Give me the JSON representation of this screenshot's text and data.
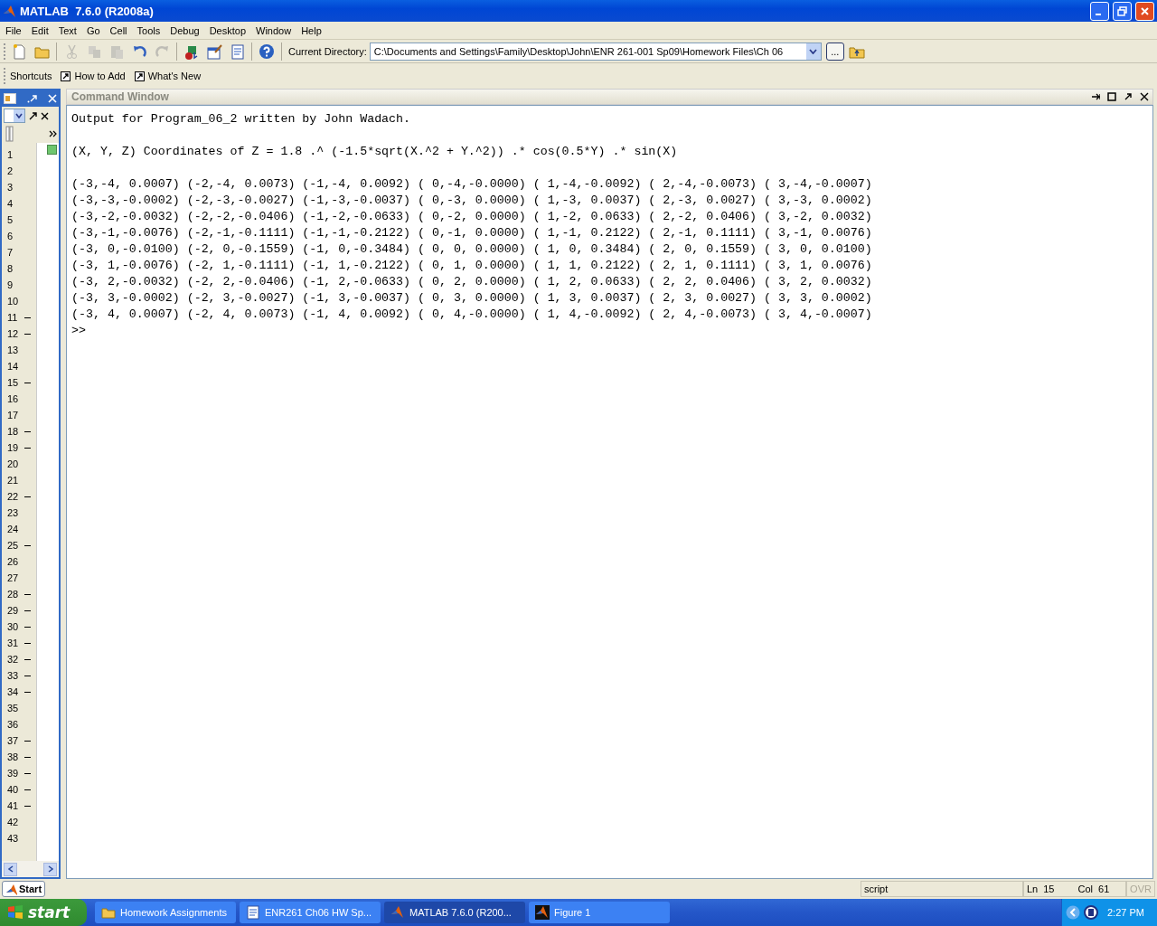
{
  "window": {
    "title": "MATLAB  7.6.0 (R2008a)"
  },
  "menu": [
    "File",
    "Edit",
    "Text",
    "Go",
    "Cell",
    "Tools",
    "Debug",
    "Desktop",
    "Window",
    "Help"
  ],
  "toolbar": {
    "tools": [
      {
        "kind": "new",
        "disabled": false
      },
      {
        "kind": "open",
        "disabled": false
      },
      {
        "kind": "sep"
      },
      {
        "kind": "cut",
        "disabled": true
      },
      {
        "kind": "copy",
        "disabled": true
      },
      {
        "kind": "paste",
        "disabled": true
      },
      {
        "kind": "undo",
        "disabled": false
      },
      {
        "kind": "redo",
        "disabled": true
      },
      {
        "kind": "sep"
      },
      {
        "kind": "simulink",
        "disabled": false
      },
      {
        "kind": "guide",
        "disabled": false
      },
      {
        "kind": "profiler",
        "disabled": false
      },
      {
        "kind": "sep"
      },
      {
        "kind": "help",
        "disabled": false
      },
      {
        "kind": "sep"
      }
    ],
    "directory_label": "Current Directory:",
    "directory": "C:\\Documents and Settings\\Family\\Desktop\\John\\ENR 261-001 Sp09\\Homework Files\\Ch 06",
    "browse": "..."
  },
  "shortcuts": {
    "label": "Shortcuts",
    "items": [
      "How to Add",
      "What's New"
    ]
  },
  "side_panel": {
    "lines": [
      {
        "number": "1",
        "marker": false
      },
      {
        "number": "2",
        "marker": false
      },
      {
        "number": "3",
        "marker": false
      },
      {
        "number": "4",
        "marker": false
      },
      {
        "number": "5",
        "marker": false
      },
      {
        "number": "6",
        "marker": false
      },
      {
        "number": "7",
        "marker": false
      },
      {
        "number": "8",
        "marker": false
      },
      {
        "number": "9",
        "marker": false
      },
      {
        "number": "10",
        "marker": false
      },
      {
        "number": "11",
        "marker": true
      },
      {
        "number": "12",
        "marker": true
      },
      {
        "number": "13",
        "marker": false
      },
      {
        "number": "14",
        "marker": false
      },
      {
        "number": "15",
        "marker": true
      },
      {
        "number": "16",
        "marker": false
      },
      {
        "number": "17",
        "marker": false
      },
      {
        "number": "18",
        "marker": true
      },
      {
        "number": "19",
        "marker": true
      },
      {
        "number": "20",
        "marker": false
      },
      {
        "number": "21",
        "marker": false
      },
      {
        "number": "22",
        "marker": true
      },
      {
        "number": "23",
        "marker": false
      },
      {
        "number": "24",
        "marker": false
      },
      {
        "number": "25",
        "marker": true
      },
      {
        "number": "26",
        "marker": false
      },
      {
        "number": "27",
        "marker": false
      },
      {
        "number": "28",
        "marker": true
      },
      {
        "number": "29",
        "marker": true
      },
      {
        "number": "30",
        "marker": true
      },
      {
        "number": "31",
        "marker": true
      },
      {
        "number": "32",
        "marker": true
      },
      {
        "number": "33",
        "marker": true
      },
      {
        "number": "34",
        "marker": true
      },
      {
        "number": "35",
        "marker": false
      },
      {
        "number": "36",
        "marker": false
      },
      {
        "number": "37",
        "marker": true
      },
      {
        "number": "38",
        "marker": true
      },
      {
        "number": "39",
        "marker": true
      },
      {
        "number": "40",
        "marker": true
      },
      {
        "number": "41",
        "marker": true
      },
      {
        "number": "42",
        "marker": false
      },
      {
        "number": "43",
        "marker": false
      }
    ]
  },
  "command_window": {
    "title": "Command Window",
    "output": [
      {
        "kind": "header",
        "text": "Output for Program_06_2 written by John Wadach."
      },
      {
        "kind": "header",
        "text": "(X, Y, Z) Coordinates of Z = 1.8 .^ (-1.5*sqrt(X.^2 + Y.^2)) .* cos(0.5*Y) .* sin(X)"
      },
      {
        "kind": "row",
        "text": "(-3,-4, 0.0007) (-2,-4, 0.0073) (-1,-4, 0.0092) ( 0,-4,-0.0000) ( 1,-4,-0.0092) ( 2,-4,-0.0073) ( 3,-4,-0.0007)"
      },
      {
        "kind": "row",
        "text": "(-3,-3,-0.0002) (-2,-3,-0.0027) (-1,-3,-0.0037) ( 0,-3, 0.0000) ( 1,-3, 0.0037) ( 2,-3, 0.0027) ( 3,-3, 0.0002)"
      },
      {
        "kind": "row",
        "text": "(-3,-2,-0.0032) (-2,-2,-0.0406) (-1,-2,-0.0633) ( 0,-2, 0.0000) ( 1,-2, 0.0633) ( 2,-2, 0.0406) ( 3,-2, 0.0032)"
      },
      {
        "kind": "row",
        "text": "(-3,-1,-0.0076) (-2,-1,-0.1111) (-1,-1,-0.2122) ( 0,-1, 0.0000) ( 1,-1, 0.2122) ( 2,-1, 0.1111) ( 3,-1, 0.0076)"
      },
      {
        "kind": "row",
        "text": "(-3, 0,-0.0100) (-2, 0,-0.1559) (-1, 0,-0.3484) ( 0, 0, 0.0000) ( 1, 0, 0.3484) ( 2, 0, 0.1559) ( 3, 0, 0.0100)"
      },
      {
        "kind": "row",
        "text": "(-3, 1,-0.0076) (-2, 1,-0.1111) (-1, 1,-0.2122) ( 0, 1, 0.0000) ( 1, 1, 0.2122) ( 2, 1, 0.1111) ( 3, 1, 0.0076)"
      },
      {
        "kind": "row",
        "text": "(-3, 2,-0.0032) (-2, 2,-0.0406) (-1, 2,-0.0633) ( 0, 2, 0.0000) ( 1, 2, 0.0633) ( 2, 2, 0.0406) ( 3, 2, 0.0032)"
      },
      {
        "kind": "row",
        "text": "(-3, 3,-0.0002) (-2, 3,-0.0027) (-1, 3,-0.0037) ( 0, 3, 0.0000) ( 1, 3, 0.0037) ( 2, 3, 0.0027) ( 3, 3, 0.0002)"
      },
      {
        "kind": "row",
        "text": "(-3, 4, 0.0007) (-2, 4, 0.0073) (-1, 4, 0.0092) ( 0, 4,-0.0000) ( 1, 4,-0.0092) ( 2, 4,-0.0073) ( 3, 4,-0.0007)"
      },
      {
        "kind": "prompt",
        "text": ">>"
      }
    ]
  },
  "status_bar": {
    "start": "Start",
    "mode": "script",
    "ln_label": "Ln",
    "ln": "15",
    "col_label": "Col",
    "col": "61",
    "ovr": "OVR",
    "ovr_disabled": true
  },
  "taskbar": {
    "start": "start",
    "items": [
      {
        "kind": "folder",
        "label": "Homework Assignments",
        "selected": false
      },
      {
        "kind": "document",
        "label": "ENR261 Ch06 HW Sp...",
        "selected": false
      },
      {
        "kind": "matlab",
        "label": "MATLAB  7.6.0 (R200...",
        "selected": true
      },
      {
        "kind": "figure",
        "label": "Figure 1",
        "selected": false
      }
    ],
    "clock": "2:27 PM"
  }
}
